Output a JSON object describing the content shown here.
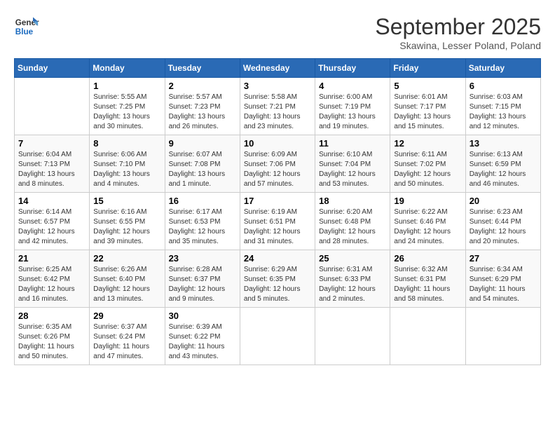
{
  "header": {
    "logo_line1": "General",
    "logo_line2": "Blue",
    "month": "September 2025",
    "location": "Skawina, Lesser Poland, Poland"
  },
  "columns": [
    "Sunday",
    "Monday",
    "Tuesday",
    "Wednesday",
    "Thursday",
    "Friday",
    "Saturday"
  ],
  "weeks": [
    [
      {
        "day": "",
        "info": ""
      },
      {
        "day": "1",
        "info": "Sunrise: 5:55 AM\nSunset: 7:25 PM\nDaylight: 13 hours\nand 30 minutes."
      },
      {
        "day": "2",
        "info": "Sunrise: 5:57 AM\nSunset: 7:23 PM\nDaylight: 13 hours\nand 26 minutes."
      },
      {
        "day": "3",
        "info": "Sunrise: 5:58 AM\nSunset: 7:21 PM\nDaylight: 13 hours\nand 23 minutes."
      },
      {
        "day": "4",
        "info": "Sunrise: 6:00 AM\nSunset: 7:19 PM\nDaylight: 13 hours\nand 19 minutes."
      },
      {
        "day": "5",
        "info": "Sunrise: 6:01 AM\nSunset: 7:17 PM\nDaylight: 13 hours\nand 15 minutes."
      },
      {
        "day": "6",
        "info": "Sunrise: 6:03 AM\nSunset: 7:15 PM\nDaylight: 13 hours\nand 12 minutes."
      }
    ],
    [
      {
        "day": "7",
        "info": "Sunrise: 6:04 AM\nSunset: 7:13 PM\nDaylight: 13 hours\nand 8 minutes."
      },
      {
        "day": "8",
        "info": "Sunrise: 6:06 AM\nSunset: 7:10 PM\nDaylight: 13 hours\nand 4 minutes."
      },
      {
        "day": "9",
        "info": "Sunrise: 6:07 AM\nSunset: 7:08 PM\nDaylight: 13 hours\nand 1 minute."
      },
      {
        "day": "10",
        "info": "Sunrise: 6:09 AM\nSunset: 7:06 PM\nDaylight: 12 hours\nand 57 minutes."
      },
      {
        "day": "11",
        "info": "Sunrise: 6:10 AM\nSunset: 7:04 PM\nDaylight: 12 hours\nand 53 minutes."
      },
      {
        "day": "12",
        "info": "Sunrise: 6:11 AM\nSunset: 7:02 PM\nDaylight: 12 hours\nand 50 minutes."
      },
      {
        "day": "13",
        "info": "Sunrise: 6:13 AM\nSunset: 6:59 PM\nDaylight: 12 hours\nand 46 minutes."
      }
    ],
    [
      {
        "day": "14",
        "info": "Sunrise: 6:14 AM\nSunset: 6:57 PM\nDaylight: 12 hours\nand 42 minutes."
      },
      {
        "day": "15",
        "info": "Sunrise: 6:16 AM\nSunset: 6:55 PM\nDaylight: 12 hours\nand 39 minutes."
      },
      {
        "day": "16",
        "info": "Sunrise: 6:17 AM\nSunset: 6:53 PM\nDaylight: 12 hours\nand 35 minutes."
      },
      {
        "day": "17",
        "info": "Sunrise: 6:19 AM\nSunset: 6:51 PM\nDaylight: 12 hours\nand 31 minutes."
      },
      {
        "day": "18",
        "info": "Sunrise: 6:20 AM\nSunset: 6:48 PM\nDaylight: 12 hours\nand 28 minutes."
      },
      {
        "day": "19",
        "info": "Sunrise: 6:22 AM\nSunset: 6:46 PM\nDaylight: 12 hours\nand 24 minutes."
      },
      {
        "day": "20",
        "info": "Sunrise: 6:23 AM\nSunset: 6:44 PM\nDaylight: 12 hours\nand 20 minutes."
      }
    ],
    [
      {
        "day": "21",
        "info": "Sunrise: 6:25 AM\nSunset: 6:42 PM\nDaylight: 12 hours\nand 16 minutes."
      },
      {
        "day": "22",
        "info": "Sunrise: 6:26 AM\nSunset: 6:40 PM\nDaylight: 12 hours\nand 13 minutes."
      },
      {
        "day": "23",
        "info": "Sunrise: 6:28 AM\nSunset: 6:37 PM\nDaylight: 12 hours\nand 9 minutes."
      },
      {
        "day": "24",
        "info": "Sunrise: 6:29 AM\nSunset: 6:35 PM\nDaylight: 12 hours\nand 5 minutes."
      },
      {
        "day": "25",
        "info": "Sunrise: 6:31 AM\nSunset: 6:33 PM\nDaylight: 12 hours\nand 2 minutes."
      },
      {
        "day": "26",
        "info": "Sunrise: 6:32 AM\nSunset: 6:31 PM\nDaylight: 11 hours\nand 58 minutes."
      },
      {
        "day": "27",
        "info": "Sunrise: 6:34 AM\nSunset: 6:29 PM\nDaylight: 11 hours\nand 54 minutes."
      }
    ],
    [
      {
        "day": "28",
        "info": "Sunrise: 6:35 AM\nSunset: 6:26 PM\nDaylight: 11 hours\nand 50 minutes."
      },
      {
        "day": "29",
        "info": "Sunrise: 6:37 AM\nSunset: 6:24 PM\nDaylight: 11 hours\nand 47 minutes."
      },
      {
        "day": "30",
        "info": "Sunrise: 6:39 AM\nSunset: 6:22 PM\nDaylight: 11 hours\nand 43 minutes."
      },
      {
        "day": "",
        "info": ""
      },
      {
        "day": "",
        "info": ""
      },
      {
        "day": "",
        "info": ""
      },
      {
        "day": "",
        "info": ""
      }
    ]
  ]
}
